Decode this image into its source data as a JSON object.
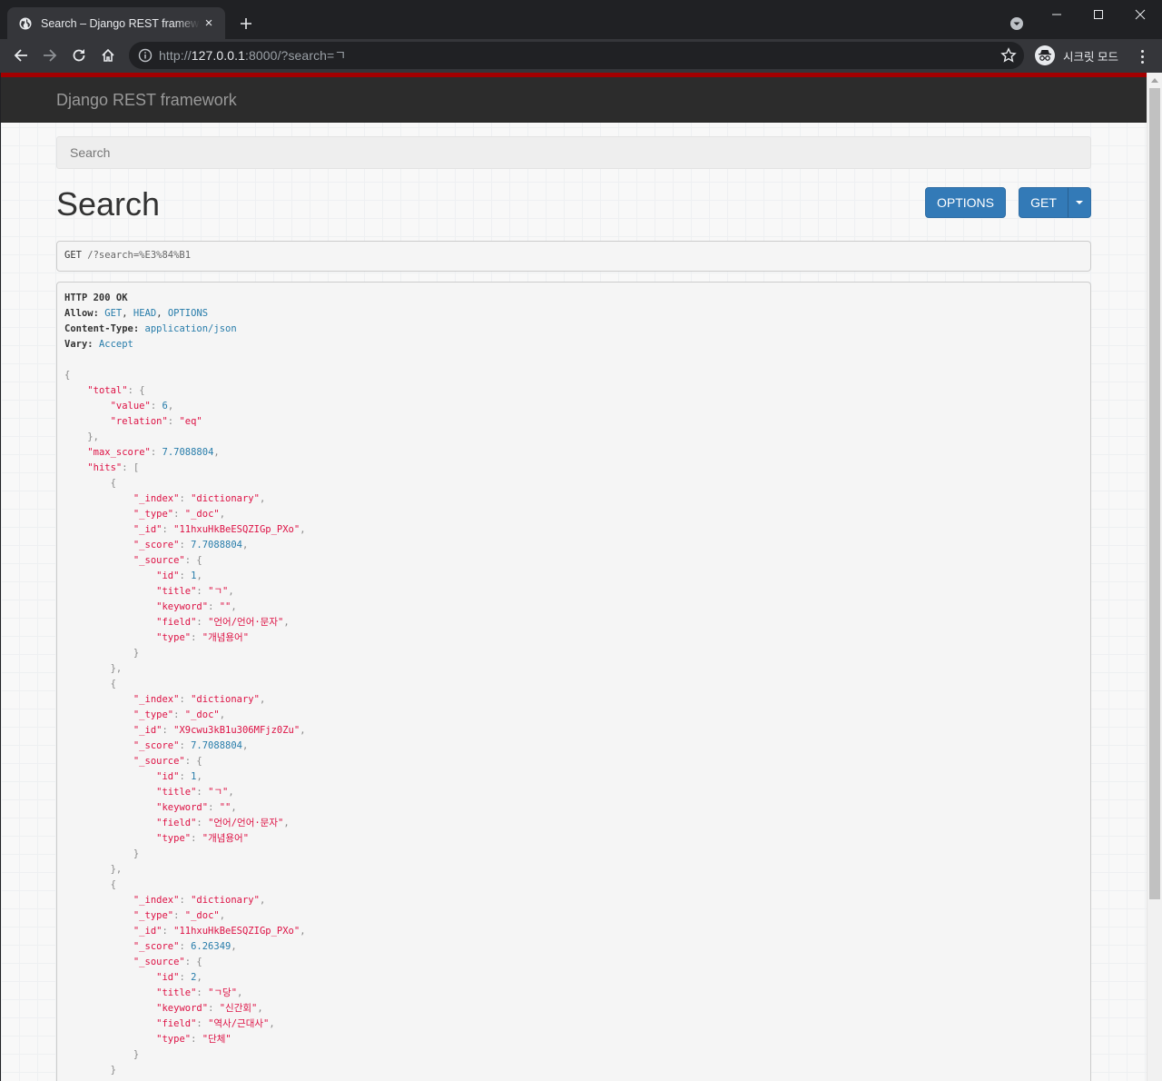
{
  "browser": {
    "tab_title": "Search – Django REST framework",
    "tab_close": "×",
    "new_tab": "+",
    "url_scheme": "http://",
    "url_host": "127.0.0.1",
    "url_rest": ":8000/?search=ㄱ",
    "incognito_label": "시크릿 모드"
  },
  "page": {
    "brand": "Django REST framework",
    "search_placeholder": "Search",
    "title": "Search",
    "options_button": "OPTIONS",
    "get_button": "GET"
  },
  "request": {
    "method": "GET",
    "path": " /?search=%E3%84%B1"
  },
  "response": {
    "status": "HTTP 200 OK",
    "headers": [
      {
        "name": "Allow",
        "value": "GET, HEAD, OPTIONS"
      },
      {
        "name": "Content-Type",
        "value": "application/json"
      },
      {
        "name": "Vary",
        "value": "Accept"
      }
    ],
    "body": {
      "total": {
        "value": 6,
        "relation": "eq"
      },
      "max_score": 7.7088804,
      "hits": [
        {
          "_index": "dictionary",
          "_type": "_doc",
          "_id": "11hxuHkBeESQZIGp_PXo",
          "_score": 7.7088804,
          "_source": {
            "id": 1,
            "title": "ㄱ",
            "keyword": "",
            "field": "언어/언어·문자",
            "type": "개념용어"
          }
        },
        {
          "_index": "dictionary",
          "_type": "_doc",
          "_id": "X9cwu3kB1u306MFjz0Zu",
          "_score": 7.7088804,
          "_source": {
            "id": 1,
            "title": "ㄱ",
            "keyword": "",
            "field": "언어/언어·문자",
            "type": "개념용어"
          }
        },
        {
          "_index": "dictionary",
          "_type": "_doc",
          "_id": "11hxuHkBeESQZIGp_PXo",
          "_score": 6.26349,
          "_source": {
            "id": 2,
            "title": "ㄱ당",
            "keyword": "신간회",
            "field": "역사/근대사",
            "type": "단체"
          }
        }
      ]
    }
  }
}
